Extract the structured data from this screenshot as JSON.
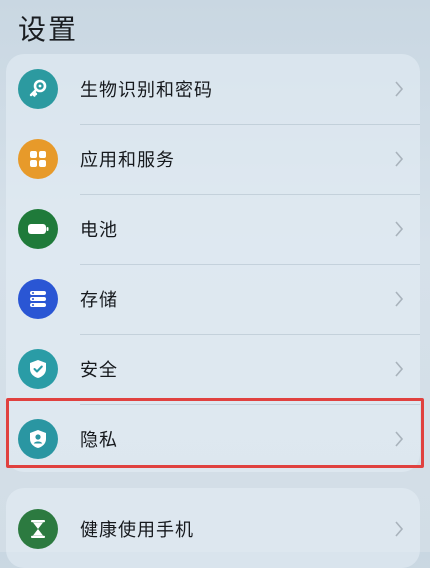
{
  "header": {
    "title": "设置"
  },
  "colors": {
    "biometrics": "#2c9aa0",
    "apps": "#e79a2a",
    "battery": "#1f7a3a",
    "storage": "#2a56d4",
    "security": "#2a9ca6",
    "privacy": "#2a96a2",
    "wellbeing": "#2c7a40",
    "highlight": "#e0413f"
  },
  "settings": {
    "items": [
      {
        "label": "生物识别和密码",
        "icon": "key-icon"
      },
      {
        "label": "应用和服务",
        "icon": "apps-grid-icon"
      },
      {
        "label": "电池",
        "icon": "battery-icon"
      },
      {
        "label": "存储",
        "icon": "storage-icon"
      },
      {
        "label": "安全",
        "icon": "shield-check-icon"
      },
      {
        "label": "隐私",
        "icon": "privacy-shield-icon"
      }
    ],
    "wellbeing": {
      "label": "健康使用手机",
      "icon": "hourglass-icon"
    }
  }
}
